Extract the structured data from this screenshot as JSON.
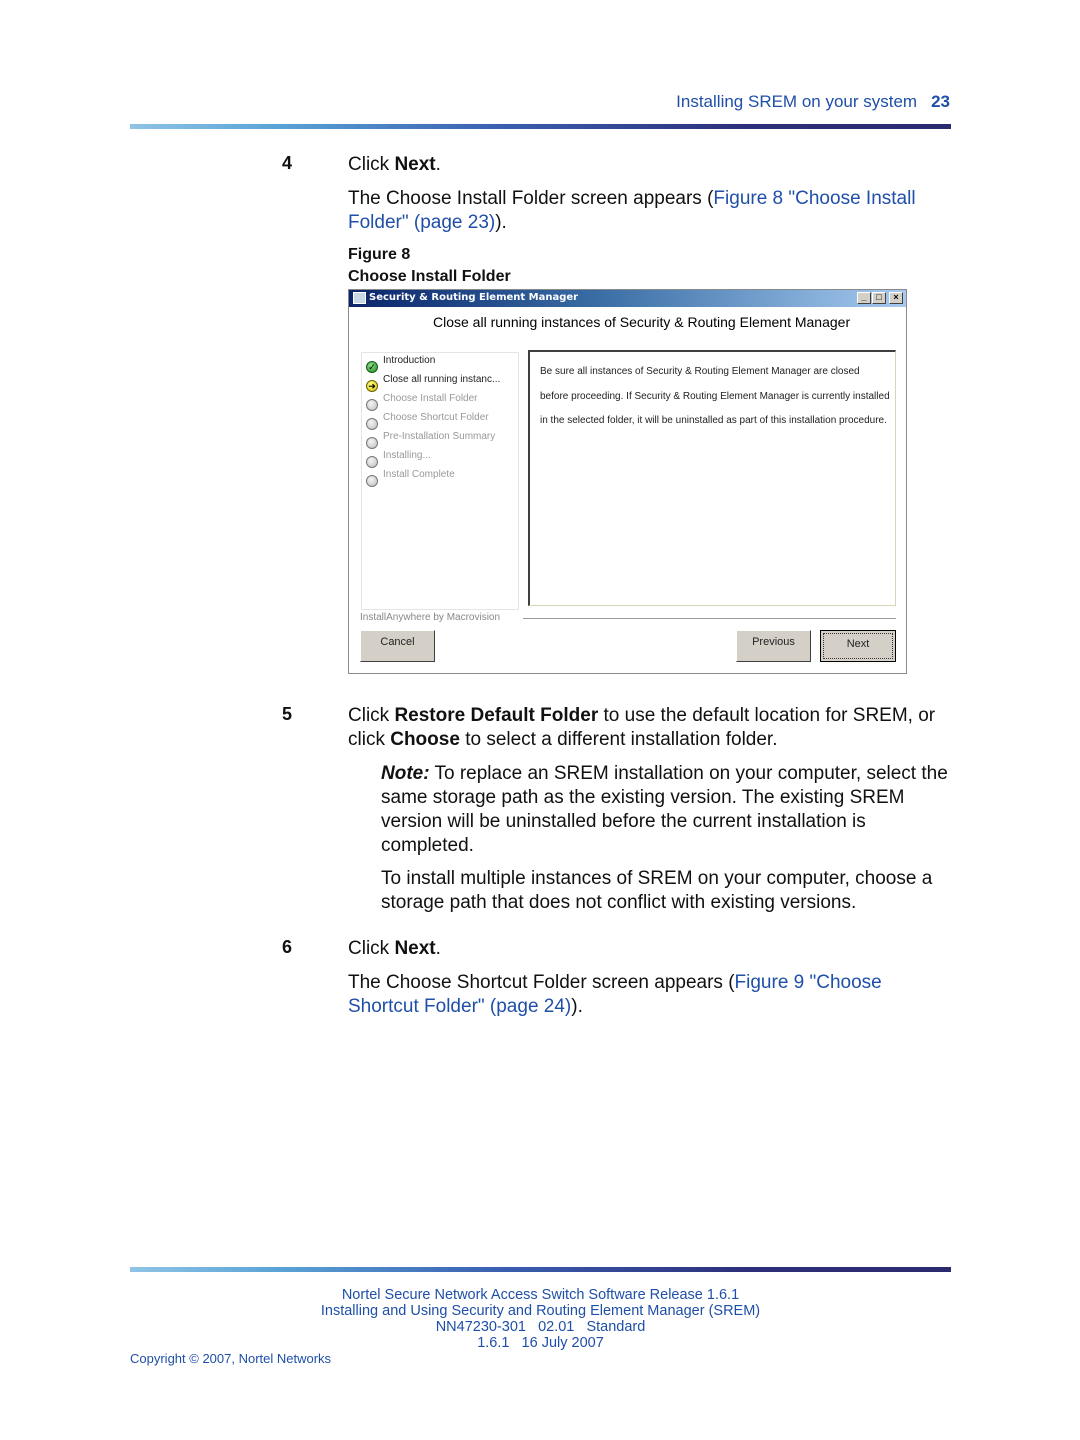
{
  "header": {
    "section_title": "Installing SREM on your system",
    "page_number": "23"
  },
  "steps": [
    {
      "number": "4",
      "instruction_prefix": "Click ",
      "instruction_bold": "Next",
      "instruction_suffix": ".",
      "result_text": "The Choose Install Folder screen appears (",
      "result_link": "Figure 8 \"Choose Install Folder\" (page 23)",
      "result_suffix": ")."
    },
    {
      "number": "5",
      "text_1": "Click ",
      "bold_1": "Restore Default Folder",
      "text_2": " to use the default location for SREM, or click ",
      "bold_2": "Choose",
      "text_3": " to select a different installation folder.",
      "note_label": "Note:",
      "note_text": " To replace an SREM installation on your computer, select the same storage path as the existing version.  The existing SREM version will be uninstalled before the current installation is completed.",
      "extra_text": "To install multiple instances of SREM on your computer, choose a storage path that does not conflict with existing versions."
    },
    {
      "number": "6",
      "instruction_prefix": "Click ",
      "instruction_bold": "Next",
      "instruction_suffix": ".",
      "result_text": "The Choose Shortcut Folder screen appears (",
      "result_link": "Figure 9 \"Choose Shortcut Folder\" (page 24)",
      "result_suffix": ")."
    }
  ],
  "figure": {
    "label": "Figure 8",
    "caption": "Choose Install Folder",
    "window": {
      "title": "Security & Routing Element Manager",
      "controls": {
        "minimize": "_",
        "maximize": "□",
        "close": "×"
      },
      "heading": "Close all running instances of Security & Routing Element Manager",
      "install_steps": [
        {
          "label": "Introduction",
          "state": "done"
        },
        {
          "label": "Close all running instanc...",
          "state": "current"
        },
        {
          "label": "Choose Install Folder",
          "state": "pending"
        },
        {
          "label": "Choose Shortcut Folder",
          "state": "pending"
        },
        {
          "label": "Pre-Installation Summary",
          "state": "pending"
        },
        {
          "label": "Installing...",
          "state": "pending"
        },
        {
          "label": "Install Complete",
          "state": "pending"
        }
      ],
      "message": "Be sure all instances of Security & Routing Element Manager are closed before proceeding. If Security & Routing Element Manager is currently installed in the selected folder, it will be uninstalled as part of this installation procedure.",
      "branding": "InstallAnywhere by Macrovision",
      "buttons": {
        "cancel": "Cancel",
        "previous": "Previous",
        "next": "Next"
      }
    }
  },
  "footer": {
    "line1": "Nortel Secure Network Access Switch Software Release 1.6.1",
    "line2": "Installing and Using Security and Routing Element Manager (SREM)",
    "line3": "NN47230-301   02.01   Standard",
    "line4": "1.6.1   16 July 2007",
    "copyright": "Copyright © 2007, Nortel Networks"
  }
}
